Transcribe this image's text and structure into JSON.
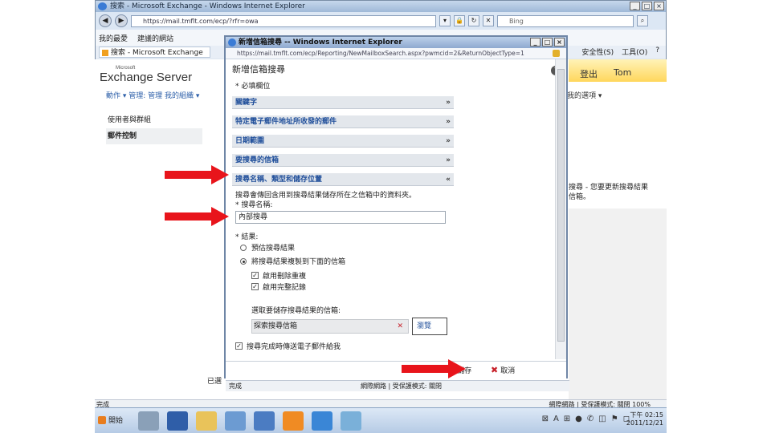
{
  "ie": {
    "title": "搜索 - Microsoft Exchange - Windows Internet Explorer",
    "address": "https://mail.tmflt.com/ecp/?rfr=owa",
    "search_placeholder": "Bing",
    "favorites": "我的最愛",
    "suggested_sites": "建議的網站",
    "tab_label": "搜索 - Microsoft Exchange",
    "tools": [
      "安全性(S)",
      "工具(O)"
    ],
    "status_left": "完成",
    "status_right": "網際網路 | 受保護模式: 關閉",
    "zoom": "100%"
  },
  "owa": {
    "product_small": "Microsoft",
    "product": "Exchange Server",
    "signout": "登出",
    "user": "Tom",
    "nav_line": "動作 ▾  管理: 管理 我的組織 ▾",
    "my_options": "我的選項",
    "sidebar": [
      "使用者與群組",
      "郵件控制"
    ],
    "right_text": "搜尋 - 您要更新搜尋結果",
    "right_text2": "信箱。",
    "left_bottom_text": "已選"
  },
  "popup": {
    "title": "新增信箱搜尋 -- Windows Internet Explorer",
    "address": "https://mail.tmflt.com/ecp/Reporting/NewMailboxSearch.aspx?pwmcid=2&ReturnObjectType=1",
    "form_title": "新增信箱搜尋",
    "required_note": "* 必填欄位",
    "sections": [
      {
        "label": "關鍵字",
        "expanded": false
      },
      {
        "label": "特定電子郵件地址所收發的郵件",
        "expanded": false
      },
      {
        "label": "日期範圍",
        "expanded": false
      },
      {
        "label": "要搜尋的信箱",
        "expanded": false
      },
      {
        "label": "搜尋名稱、類型和儲存位置",
        "expanded": true
      }
    ],
    "description": "搜尋會傳回含用到搜尋結果儲存所在之信箱中的資料夾。",
    "name_label": "* 搜尋名稱:",
    "name_value": "內部搜尋",
    "results_label": "* 結果:",
    "options": [
      {
        "label": "預估搜尋結果",
        "selected": false
      },
      {
        "label": "將搜尋結果複製到下面的信箱",
        "selected": true
      }
    ],
    "checkboxes": [
      {
        "label": "啟用刪除重複",
        "checked": true
      },
      {
        "label": "啟用完整記錄",
        "checked": true
      }
    ],
    "select_mailbox_label": "選取要儲存搜尋結果的信箱:",
    "mailbox_value": "探索搜尋信箱",
    "browse_label": "瀏覽",
    "notify_label": "搜尋完成時傳送電子郵件給我",
    "notify_checked": true,
    "save_label": "儲存",
    "cancel_label": "取消",
    "status_left": "完成",
    "status_zone": "網際網路 | 受保護模式: 關閉"
  },
  "taskbar": {
    "start_label": "開始",
    "clock_time": "下午 02:15",
    "clock_date": "2011/12/21"
  },
  "colors": {
    "arrow": "#e8141b",
    "section_header": "#1f4e9a",
    "accent_owa": "#ffd75c"
  }
}
